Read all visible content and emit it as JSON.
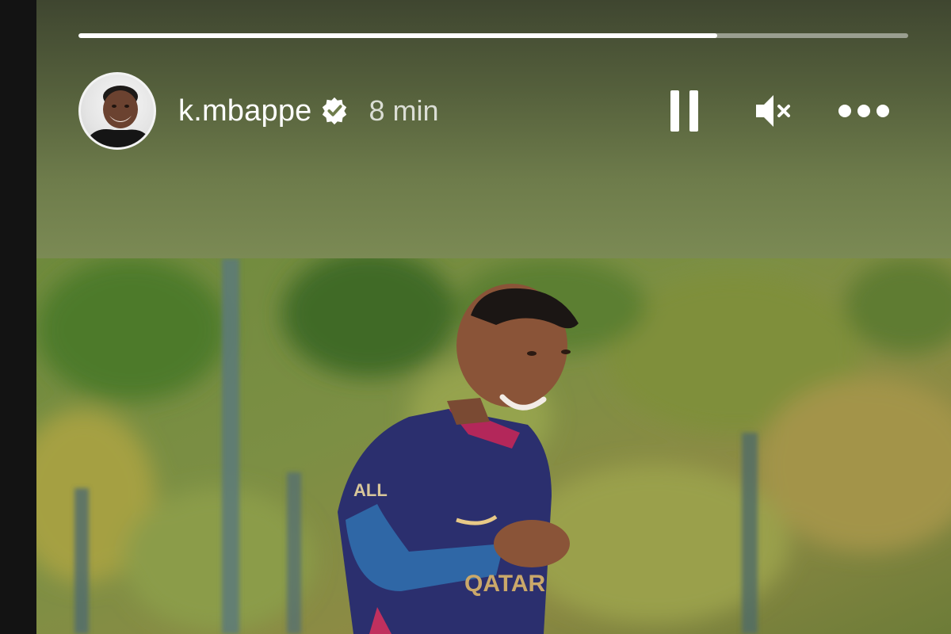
{
  "story": {
    "progress": 0.77,
    "username": "k.mbappe",
    "verified": true,
    "time_ago": "8 min",
    "controls": {
      "pause_icon": "pause-icon",
      "mute_icon": "speaker-muted-icon",
      "more_icon": "more-horizontal-icon"
    },
    "colors": {
      "header_top": "#3f4630",
      "header_bottom": "#7b8a54",
      "text": "#ffffff"
    }
  }
}
